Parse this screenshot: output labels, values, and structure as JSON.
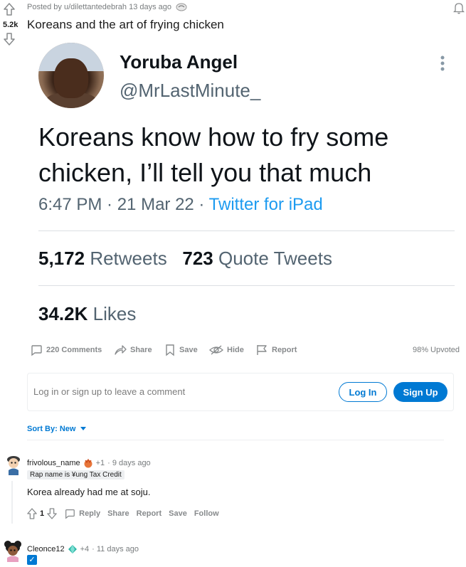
{
  "post": {
    "score": "5.2k",
    "meta": "Posted by u/dilettantedebrah 13 days ago",
    "title": "Koreans and the art of frying chicken"
  },
  "tweet": {
    "name": "Yoruba Angel",
    "handle": "@MrLastMinute_",
    "text": "Koreans know how to fry some chicken, I’ll tell you that much",
    "time": "6:47 PM · 21 Mar 22 · ",
    "source": "Twitter for iPad",
    "retweets_count": "5,172",
    "retweets_label": "Retweets",
    "quotes_count": "723",
    "quotes_label": "Quote Tweets",
    "likes_count": "34.2K",
    "likes_label": "Likes"
  },
  "actions": {
    "comments": "220 Comments",
    "share": "Share",
    "save": "Save",
    "hide": "Hide",
    "report": "Report",
    "upvoted": "98% Upvoted"
  },
  "login": {
    "prompt": "Log in or sign up to leave a comment",
    "login_label": "Log In",
    "signup_label": "Sign Up"
  },
  "sort": {
    "label": "Sort By: New"
  },
  "comments": [
    {
      "user": "frivolous_name",
      "karma": "+1",
      "time": "· 9 days ago",
      "flair": "Rap name is ¥ung Tax Credit",
      "body": "Korea already had me at soju.",
      "score": "1",
      "reply": "Reply",
      "share": "Share",
      "report": "Report",
      "save": "Save",
      "follow": "Follow"
    },
    {
      "user": "Cleonce12",
      "karma": "+4",
      "time": "· 11 days ago",
      "checkbox": "✓"
    }
  ],
  "colors": {
    "accent": "#0079d3",
    "twitter_blue": "#1d9bf0",
    "muted": "#787c7e"
  }
}
